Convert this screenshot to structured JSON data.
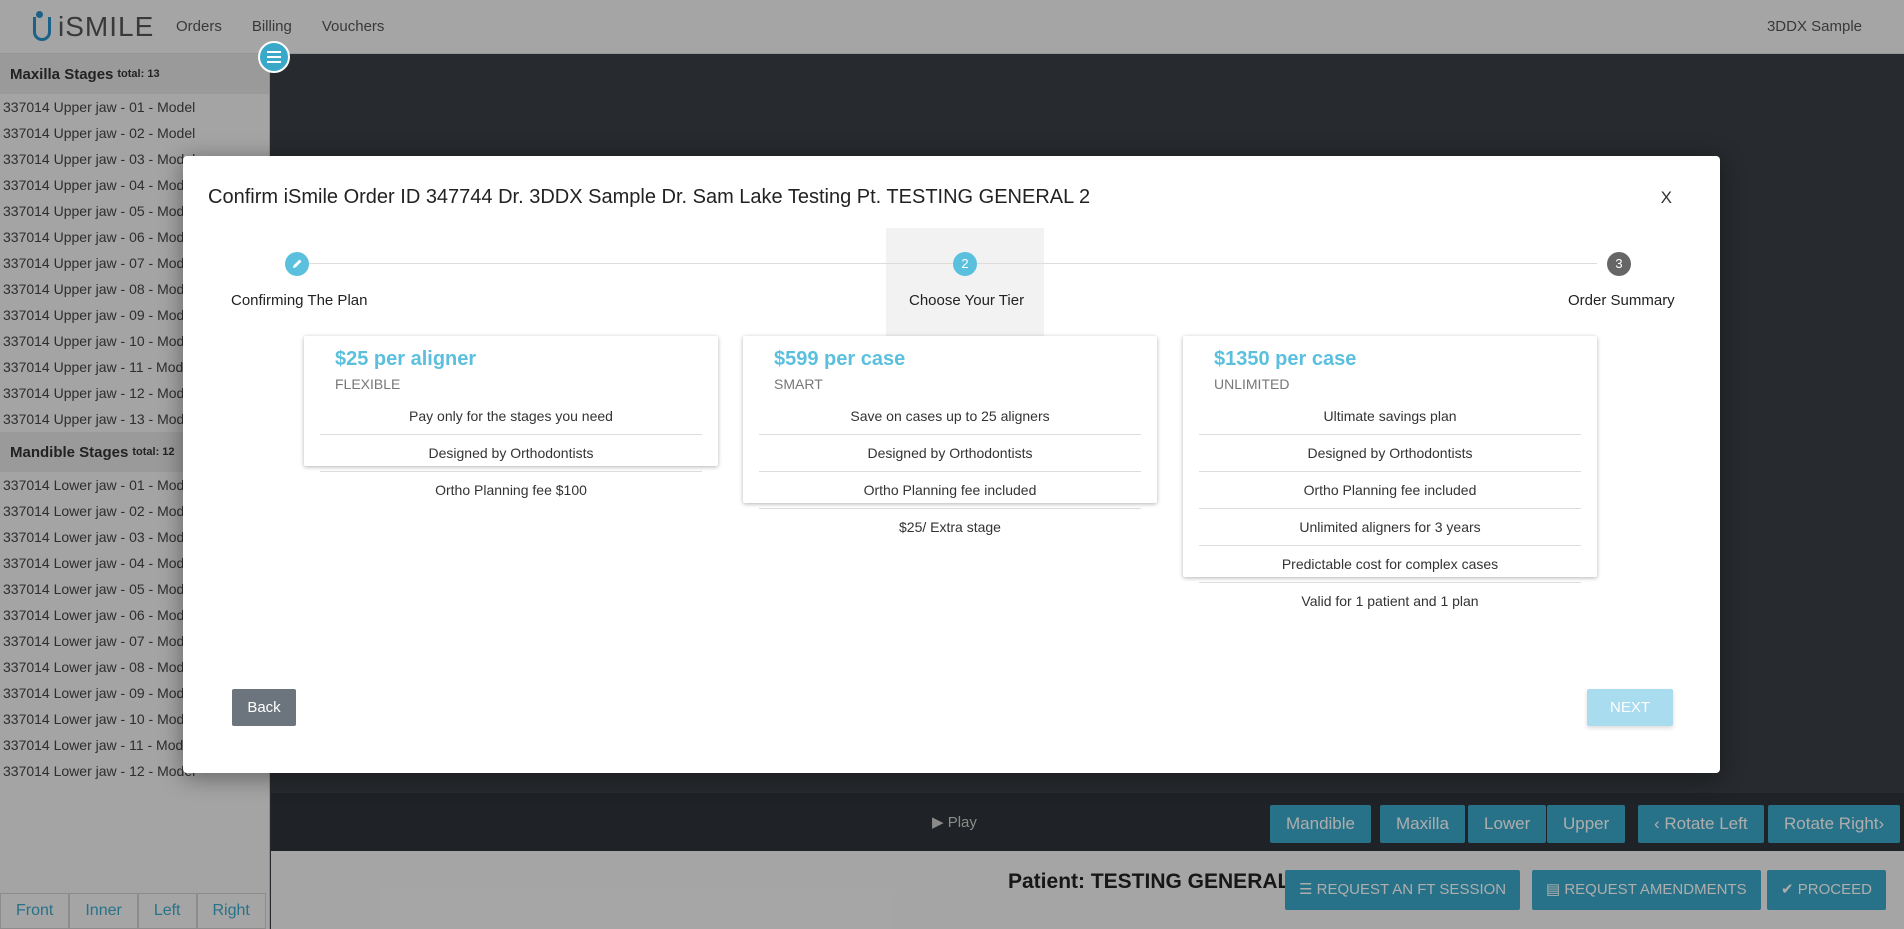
{
  "topbar": {
    "logo_text": "iSMILE",
    "nav": [
      "Orders",
      "Billing",
      "Vouchers"
    ],
    "user": "3DDX Sample"
  },
  "sidebar": {
    "maxilla": {
      "title": "Maxilla Stages",
      "total": "total: 13",
      "items": [
        "337014 Upper jaw - 01 - Model",
        "337014 Upper jaw - 02 - Model",
        "337014 Upper jaw - 03 - Model",
        "337014 Upper jaw - 04 - Model",
        "337014 Upper jaw - 05 - Model",
        "337014 Upper jaw - 06 - Model",
        "337014 Upper jaw - 07 - Model",
        "337014 Upper jaw - 08 - Model",
        "337014 Upper jaw - 09 - Model",
        "337014 Upper jaw - 10 - Model",
        "337014 Upper jaw - 11 - Model",
        "337014 Upper jaw - 12 - Model",
        "337014 Upper jaw - 13 - Model"
      ]
    },
    "mandible": {
      "title": "Mandible Stages",
      "total": "total: 12",
      "items": [
        "337014 Lower jaw - 01 - Model",
        "337014 Lower jaw - 02 - Model",
        "337014 Lower jaw - 03 - Model",
        "337014 Lower jaw - 04 - Model",
        "337014 Lower jaw - 05 - Model",
        "337014 Lower jaw - 06 - Model",
        "337014 Lower jaw - 07 - Model",
        "337014 Lower jaw - 08 - Model",
        "337014 Lower jaw - 09 - Model",
        "337014 Lower jaw - 10 - Model",
        "337014 Lower jaw - 11 - Model",
        "337014 Lower jaw - 12 - Model"
      ]
    },
    "view_buttons": [
      "Front",
      "Inner",
      "Left",
      "Right"
    ]
  },
  "controls": {
    "play": "Play",
    "buttons": [
      "Mandible",
      "Maxilla",
      "Lower",
      "Upper",
      "Rotate Left",
      "Rotate Right"
    ]
  },
  "bottom": {
    "patient": "Patient: TESTING GENERAL 2",
    "actions": [
      "REQUEST AN FT SESSION",
      "REQUEST AMENDMENTS",
      "PROCEED"
    ]
  },
  "modal": {
    "title": "Confirm iSmile Order ID 347744 Dr. 3DDX Sample Dr. Sam Lake Testing Pt. TESTING GENERAL 2",
    "close": "X",
    "steps": [
      {
        "number": "",
        "label": "Confirming The Plan"
      },
      {
        "number": "2",
        "label": "Choose Your Tier"
      },
      {
        "number": "3",
        "label": "Order Summary"
      }
    ],
    "tiers": [
      {
        "price": "$25 per aligner",
        "name": "FLEXIBLE",
        "features": [
          "Pay only for the stages you need",
          "Designed by Orthodontists",
          "Ortho Planning fee $100"
        ]
      },
      {
        "price": "$599 per case",
        "name": "SMART",
        "features": [
          "Save on cases up to 25 aligners",
          "Designed by Orthodontists",
          "Ortho Planning fee included",
          "$25/ Extra stage"
        ]
      },
      {
        "price": "$1350 per case",
        "name": "UNLIMITED",
        "features": [
          "Ultimate savings plan",
          "Designed by Orthodontists",
          "Ortho Planning fee included",
          "Unlimited aligners for 3 years",
          "Predictable cost for complex cases",
          "Valid for 1 patient and 1 plan"
        ]
      }
    ],
    "back": "Back",
    "next": "NEXT"
  },
  "colors": {
    "accent": "#3aa9c9",
    "price": "#5bc0de",
    "step_done": "#5bc0de",
    "step_pending": "#666666"
  }
}
